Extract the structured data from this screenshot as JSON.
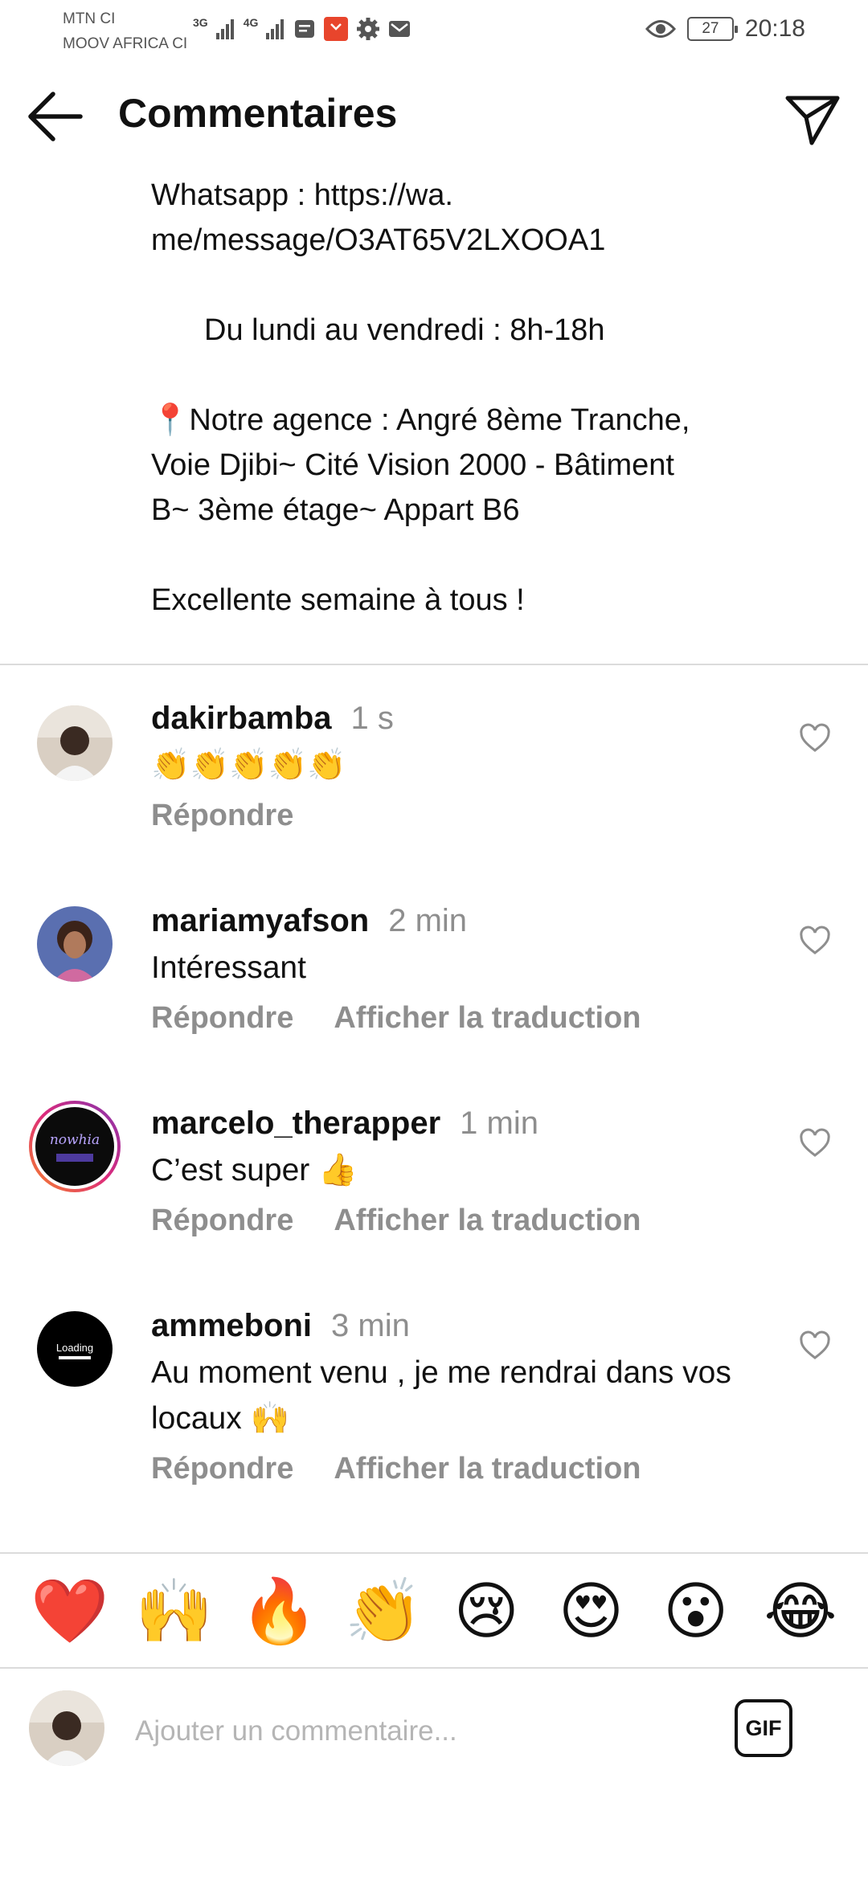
{
  "status_bar": {
    "carrier_1": "MTN CI",
    "carrier_2": "MOOV AFRICA CI",
    "net_1": "3G",
    "net_2": "4G",
    "battery": "27",
    "time": "20:18"
  },
  "header": {
    "title": "Commentaires"
  },
  "caption": {
    "line_1": "Whatsapp : https://wa.",
    "line_2": "me/message/O3AT65V2LXOOA1",
    "line_3": "Du lundi au vendredi : 8h-18h",
    "line_4": "📍Notre agence : Angré 8ème Tranche,",
    "line_5": "Voie Djibi~ Cité Vision 2000 - Bâtiment",
    "line_6": "B~ 3ème étage~ Appart B6",
    "line_7": "Excellente semaine à tous !"
  },
  "comments": [
    {
      "username": "dakirbamba",
      "time": "1 s",
      "text": "👏👏👏👏👏",
      "reply": "Répondre"
    },
    {
      "username": "mariamyafson",
      "time": "2 min",
      "text": "Intéressant",
      "reply": "Répondre",
      "translate": "Afficher la traduction"
    },
    {
      "username": "marcelo_therapper",
      "time": "1 min",
      "text": "C’est super 👍",
      "reply": "Répondre",
      "translate": "Afficher la traduction",
      "avatar_text": "nowhia"
    },
    {
      "username": "ammeboni",
      "time": "3 min",
      "text": "Au moment venu , je me rendrai dans vos locaux 🙌",
      "reply": "Répondre",
      "translate": "Afficher la traduction",
      "avatar_text": "Loading"
    }
  ],
  "emoji_bar": [
    "❤️",
    "🙌",
    "🔥",
    "👏",
    "😢",
    "😍",
    "😮",
    "😂"
  ],
  "composer": {
    "placeholder": "Ajouter un commentaire...",
    "gif_label": "GIF"
  },
  "colors": {
    "text": "#111111",
    "muted": "#8e8e8e",
    "divider": "#dbdbdb",
    "story_ring_start": "#f58529",
    "story_ring_end": "#c13584"
  }
}
